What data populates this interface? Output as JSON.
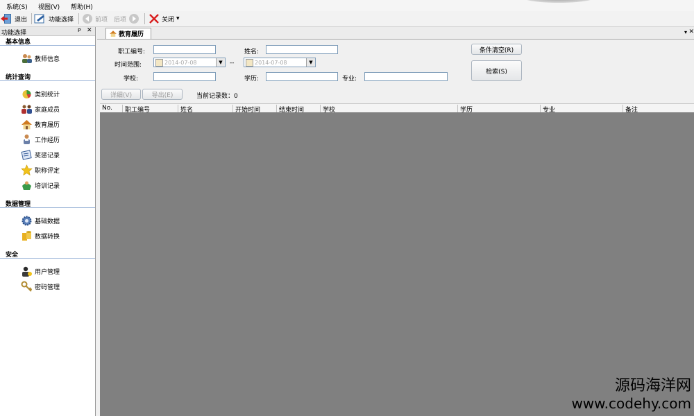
{
  "menubar": {
    "items": [
      "系统(S)",
      "视图(V)",
      "帮助(H)"
    ]
  },
  "toolbar": {
    "exit": "退出",
    "function_select": "功能选择",
    "prev": "前项",
    "next": "后项",
    "close": "关闭",
    "close_arrow": "▾"
  },
  "left_panel": {
    "title": "功能选择",
    "pin": "ᴘ",
    "close": "✕",
    "sections": [
      {
        "title": "基本信息",
        "items": [
          "教师信息"
        ]
      },
      {
        "title": "统计查询",
        "items": [
          "类别统计",
          "家庭成员",
          "教育履历",
          "工作经历",
          "奖惩记录",
          "职称评定",
          "培训记录"
        ]
      },
      {
        "title": "数据管理",
        "items": [
          "基础数据",
          "数据转换"
        ]
      },
      {
        "title": "安全",
        "items": [
          "用户管理",
          "密码管理"
        ]
      }
    ]
  },
  "tab": {
    "label": "教育履历",
    "scroll_arrow": "▾",
    "close": "✕"
  },
  "form": {
    "emp_no_label": "职工编号:",
    "name_label": "姓名:",
    "time_range_label": "时间范围:",
    "date_from": "2014-07-08",
    "date_to": "2014-07-08",
    "range_sep": "--",
    "school_label": "学校:",
    "education_label": "学历:",
    "major_label": "专业:",
    "clear_button": "条件清空(R)",
    "search_button": "检索(S)",
    "detail_button": "详细(V)",
    "export_button": "导出(E)",
    "record_count": "当前记录数：0"
  },
  "grid": {
    "columns": [
      "No.",
      "职工编号",
      "姓名",
      "开始时间",
      "结束时间",
      "学校",
      "学历",
      "专业",
      "备注"
    ]
  },
  "watermark": {
    "line1": "源码海洋网",
    "line2": "www.codehy.com"
  },
  "colors": {
    "grid_body": "#808080",
    "section_rule": "#9fb7d9"
  }
}
